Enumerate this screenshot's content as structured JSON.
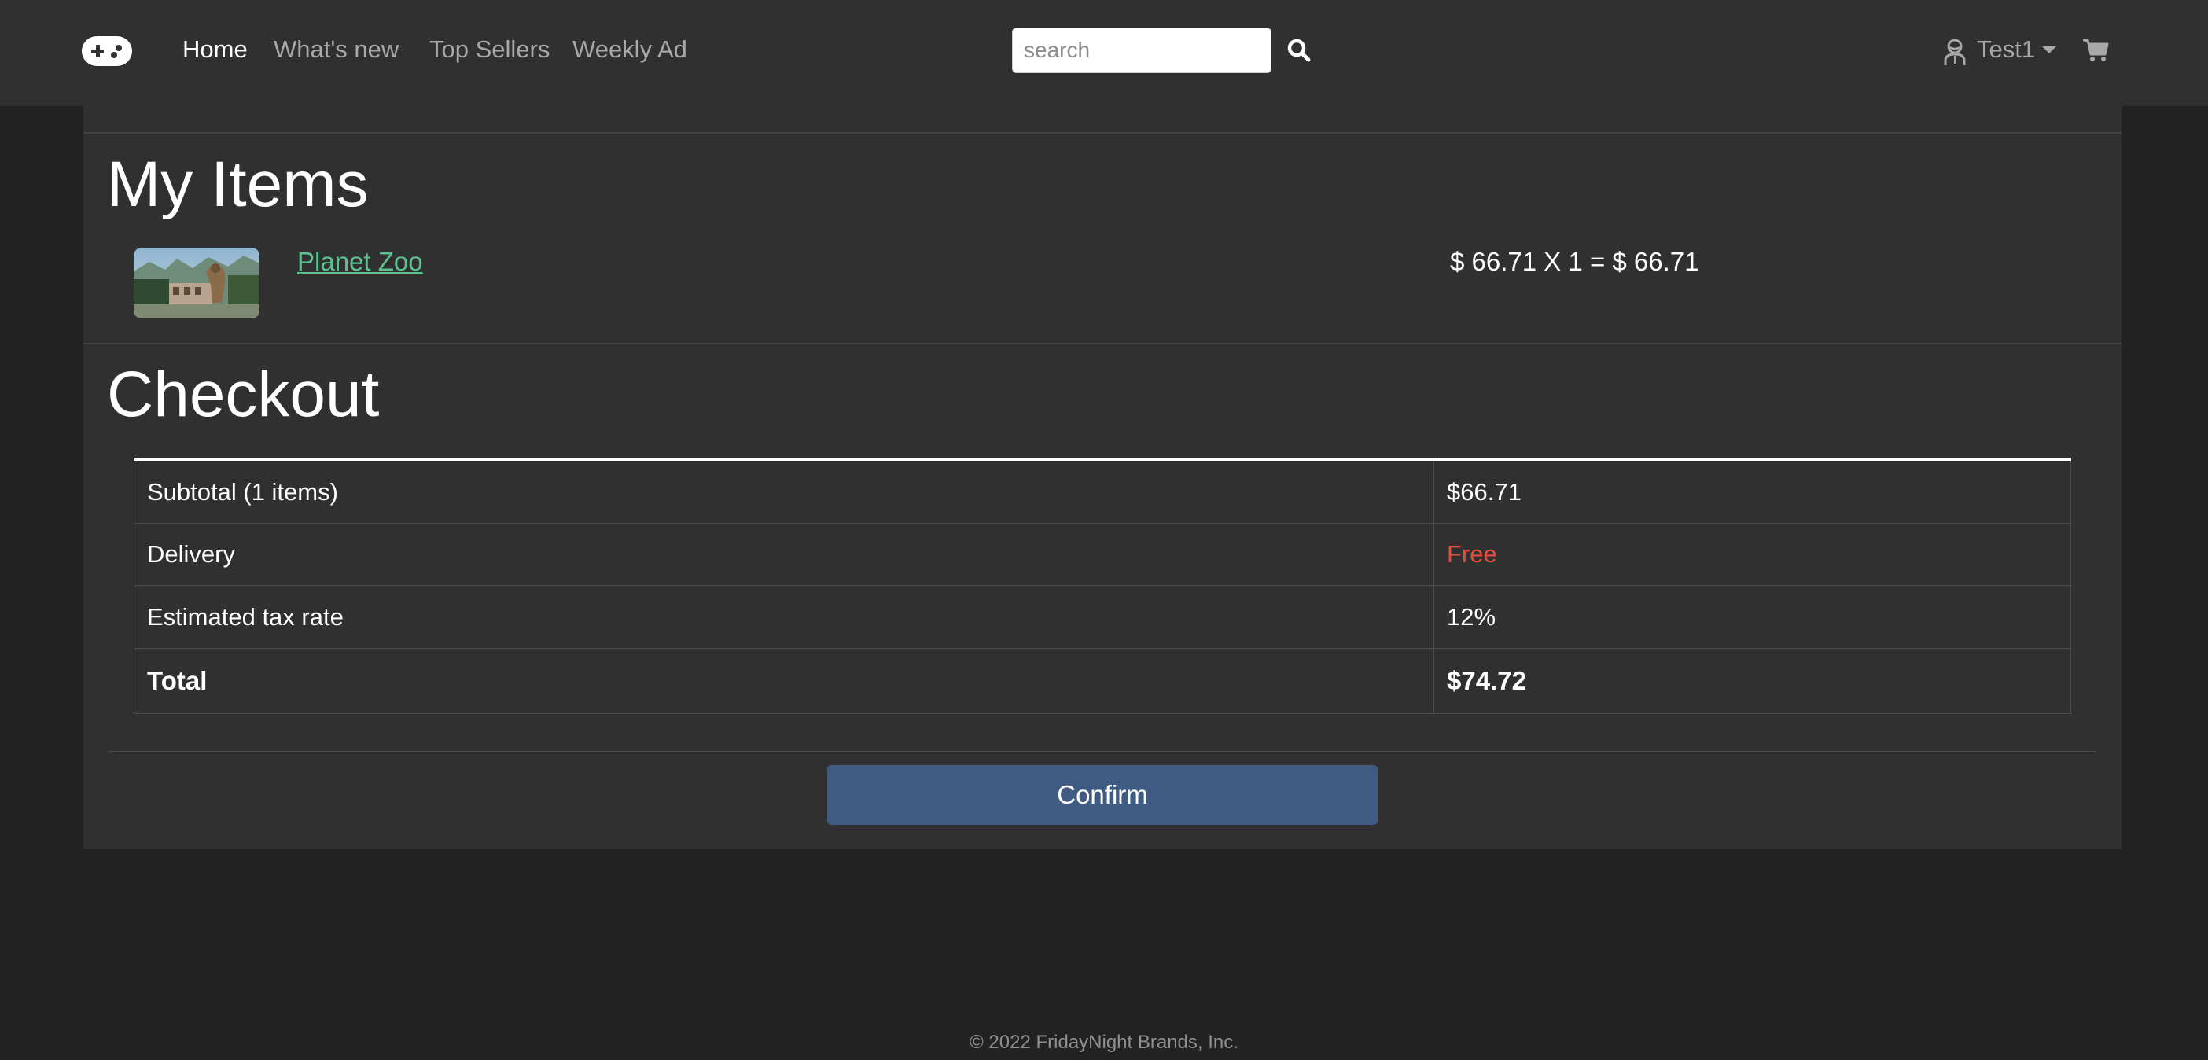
{
  "nav": {
    "logo_icon": "gamepad-icon",
    "links": [
      {
        "label": "Home",
        "active": true
      },
      {
        "label": "What's new",
        "active": false
      },
      {
        "label": "Top Sellers",
        "active": false
      },
      {
        "label": "Weekly Ad",
        "active": false
      }
    ],
    "search_placeholder": "search",
    "search_icon": "search-icon",
    "user_name": "Test1",
    "cart_icon": "cart-icon"
  },
  "my_items": {
    "title": "My Items",
    "items": [
      {
        "name": "Planet Zoo",
        "price_line": "$ 66.71 X 1 = $ 66.71"
      }
    ]
  },
  "checkout": {
    "title": "Checkout",
    "rows": [
      {
        "label": "Subtotal (1 items)",
        "value": "$66.71"
      },
      {
        "label": "Delivery",
        "value": "Free"
      },
      {
        "label": "Estimated tax rate",
        "value": "12%"
      },
      {
        "label": "Total",
        "value": "$74.72"
      }
    ],
    "confirm_label": "Confirm"
  },
  "footer": {
    "text": "© 2022 FridayNight Brands, Inc."
  },
  "colors": {
    "navbar_bg": "#303030",
    "page_bg": "#222222",
    "link_green": "#5cc08f",
    "free_red": "#e74c3c",
    "confirm_blue": "#3f5a83"
  }
}
